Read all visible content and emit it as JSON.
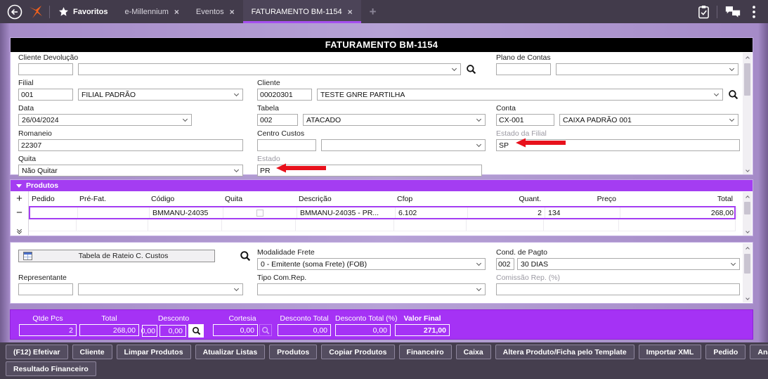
{
  "topbar": {
    "favorites": "Favoritos",
    "tabs": [
      {
        "label": "e-Millennium"
      },
      {
        "label": "Eventos"
      },
      {
        "label": "FATURAMENTO BM-1154"
      }
    ]
  },
  "form": {
    "title": "FATURAMENTO BM-1154",
    "cliente_devolucao": {
      "label": "Cliente Devolução",
      "code": "",
      "desc": ""
    },
    "plano_contas": {
      "label": "Plano de Contas",
      "code": "",
      "desc": ""
    },
    "filial": {
      "label": "Filial",
      "code": "001",
      "desc": "FILIAL PADRÃO"
    },
    "cliente": {
      "label": "Cliente",
      "code": "00020301",
      "desc": "TESTE GNRE PARTILHA"
    },
    "data": {
      "label": "Data",
      "value": "26/04/2024"
    },
    "tabela": {
      "label": "Tabela",
      "code": "002",
      "desc": "ATACADO"
    },
    "conta": {
      "label": "Conta",
      "code": "CX-001",
      "desc": "CAIXA PADRÃO 001"
    },
    "romaneio": {
      "label": "Romaneio",
      "value": "22307"
    },
    "centro_custos": {
      "label": "Centro Custos",
      "code": "",
      "desc": ""
    },
    "estado_filial": {
      "label": "Estado da Filial",
      "value": "SP"
    },
    "quita": {
      "label": "Quita",
      "value": "Não Quitar"
    },
    "estado": {
      "label": "Estado",
      "value": "PR"
    }
  },
  "produtos": {
    "section_label": "Produtos",
    "columns": [
      "Pedido",
      "Pré-Fat.",
      "Código",
      "Quita",
      "Descrição",
      "Cfop",
      "Quant.",
      "Preço",
      "Total"
    ],
    "rows": [
      {
        "pedido": "",
        "pre_fat": "",
        "codigo": "BMMANU-24035",
        "descricao": "BMMANU-24035 - PR...",
        "cfop": "6.102",
        "quant": "2",
        "preco": "134",
        "total": "268,00"
      }
    ]
  },
  "detalhes": {
    "rateio_button": "Tabela de Rateio C. Custos",
    "modalidade_frete": {
      "label": "Modalidade Frete",
      "value": "0 - Emitente (soma Frete) (FOB)"
    },
    "cond_pagto": {
      "label": "Cond. de Pagto",
      "code": "002",
      "desc": "30 DIAS"
    },
    "representante": {
      "label": "Representante",
      "code": "",
      "desc": ""
    },
    "tipo_com_rep": {
      "label": "Tipo Com.Rep.",
      "value": ""
    },
    "comissao_rep": {
      "label": "Comissão Rep. (%)",
      "value": ""
    }
  },
  "totais": {
    "qtde_pcs": {
      "label": "Qtde Pcs",
      "value": "2"
    },
    "total": {
      "label": "Total",
      "value": "268,00"
    },
    "desconto": {
      "label": "Desconto",
      "value1": "0,00",
      "value2": "0,00"
    },
    "cortesia": {
      "label": "Cortesia",
      "value": "0,00"
    },
    "desconto_total": {
      "label": "Desconto Total",
      "value": "0,00"
    },
    "desconto_total_pct": {
      "label": "Desconto Total (%)",
      "value": "0,00"
    },
    "valor_final": {
      "label": "Valor Final",
      "value": "271,00"
    }
  },
  "acoes": {
    "row1": [
      "(F12) Efetivar",
      "Cliente",
      "Limpar Produtos",
      "Atualizar Listas",
      "Produtos",
      "Copiar Produtos",
      "Financeiro",
      "Caixa",
      "Altera Produto/Ficha pelo Template",
      "Importar XML",
      "Pedido",
      "Análise de Crédito"
    ],
    "row2": [
      "Resultado Financeiro"
    ]
  },
  "colors": {
    "accent_purple": "#a43df2",
    "totals_purple": "#a532f5",
    "chrome_dark": "#423b4b",
    "logo_orange": "#f1611d",
    "arrow_red": "#e8111c"
  }
}
